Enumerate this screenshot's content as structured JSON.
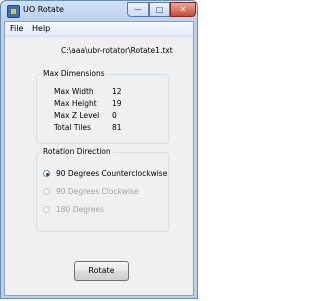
{
  "window": {
    "title": "UO Rotate",
    "min_symbol": "—",
    "max_symbol": "□",
    "close_symbol": "✕"
  },
  "menu": {
    "items": [
      "File",
      "Help"
    ]
  },
  "file_path": "C:\\aaa\\ubr-rotator\\Rotate1.txt",
  "dimensions": {
    "legend": "Max Dimensions",
    "rows": [
      {
        "label": "Max Width",
        "value": "12"
      },
      {
        "label": "Max Height",
        "value": "19"
      },
      {
        "label": "Max Z Level",
        "value": "0"
      },
      {
        "label": "Total Tiles",
        "value": "81"
      }
    ]
  },
  "rotation": {
    "legend": "Rotation Direction",
    "options": [
      {
        "label": "90 Degrees Counterclockwise",
        "selected": true,
        "enabled": true
      },
      {
        "label": "90 Degrees Clockwise",
        "selected": false,
        "enabled": false
      },
      {
        "label": "180 Degrees",
        "selected": false,
        "enabled": false
      }
    ]
  },
  "rotate_button": {
    "label": "Rotate"
  }
}
